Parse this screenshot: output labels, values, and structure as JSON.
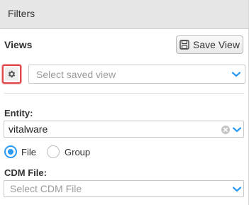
{
  "header": {
    "title": "Filters"
  },
  "views": {
    "label": "Views",
    "save_button_label": "Save View",
    "saved_view_placeholder": "Select saved view"
  },
  "entity": {
    "label": "Entity:",
    "value": "vitalware"
  },
  "type_options": [
    {
      "label": "File",
      "selected": true
    },
    {
      "label": "Group",
      "selected": false
    }
  ],
  "cdm_file": {
    "label": "CDM File:",
    "placeholder": "Select CDM File"
  },
  "colors": {
    "accent": "#2b9af3",
    "highlight_border": "#e0474c",
    "header_bg": "#e6e6e6"
  },
  "icons": [
    "save-icon",
    "gear-icon",
    "chevron-down-icon",
    "clear-icon"
  ]
}
